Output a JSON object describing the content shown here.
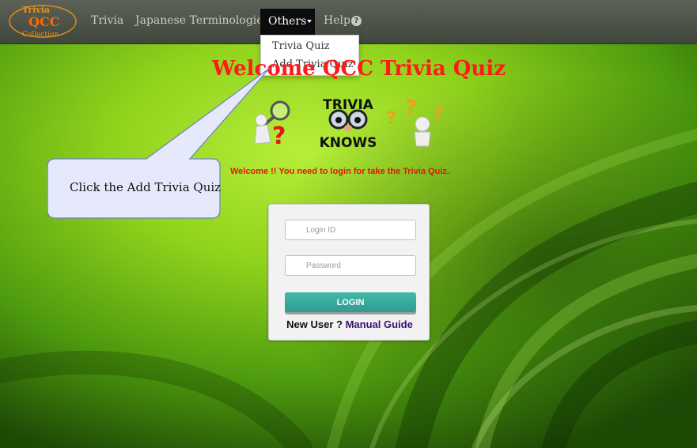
{
  "app": {
    "logo_text_top": "Trivia",
    "logo_text_mid": "QCC",
    "logo_text_bottom": "Collection"
  },
  "nav": {
    "items": [
      {
        "label": "Trivia"
      },
      {
        "label": "Japanese Terminologies"
      },
      {
        "label": "Others"
      },
      {
        "label": "Help"
      }
    ],
    "others_dropdown": [
      {
        "label": "Trivia Quiz"
      },
      {
        "label": "Add Trivia Quiz"
      }
    ]
  },
  "main": {
    "title": "Welcome QCC Trivia Quiz",
    "login_message": "Welcome !! You need to login for take the Trivia Quiz.",
    "illustration": {
      "badge_line1": "TRIVIA",
      "badge_line2": "KNOWS"
    }
  },
  "callout": {
    "text": "Click the Add Trivia Quiz"
  },
  "login": {
    "id_placeholder": "Login ID",
    "password_placeholder": "Password",
    "button_label": "LOGIN",
    "new_user_label": "New User ?",
    "manual_link": "Manual Guide"
  },
  "colors": {
    "title_red": "#ff1a1a",
    "button_teal": "#3aab9e",
    "navbar": "#4a5046"
  }
}
